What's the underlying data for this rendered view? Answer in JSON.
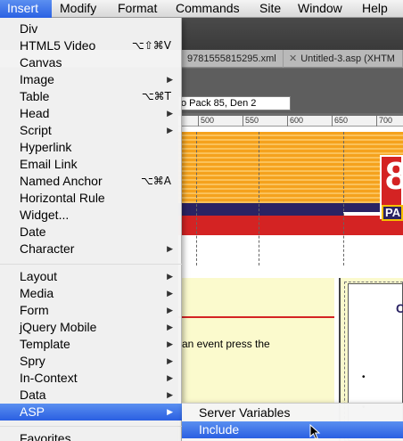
{
  "menubar": {
    "items": [
      {
        "label": "Insert"
      },
      {
        "label": "Modify"
      },
      {
        "label": "Format"
      },
      {
        "label": "Commands"
      },
      {
        "label": "Site"
      },
      {
        "label": "Window"
      },
      {
        "label": "Help"
      }
    ],
    "active_index": 0
  },
  "document": {
    "tabs": [
      {
        "label": "9781555815295.xml"
      },
      {
        "label": "Untitled-3.asp (XHTM"
      }
    ],
    "title_field_value": "o Pack 85, Den 2",
    "ruler_ticks": [
      "500",
      "550",
      "600",
      "650",
      "700"
    ],
    "logo_digit": "8",
    "logo_sub": "PA",
    "body_text": "an event press the",
    "right_heading": "C",
    "bullets": [
      "•",
      "•"
    ]
  },
  "insert_menu": {
    "items": [
      {
        "label": "Div",
        "shortcut": "",
        "submenu": false
      },
      {
        "label": "HTML5 Video",
        "shortcut": "⌥⇧⌘V",
        "submenu": false
      },
      {
        "label": "Canvas",
        "shortcut": "",
        "submenu": false
      },
      {
        "label": "Image",
        "shortcut": "",
        "submenu": true
      },
      {
        "label": "Table",
        "shortcut": "⌥⌘T",
        "submenu": false
      },
      {
        "label": "Head",
        "shortcut": "",
        "submenu": true
      },
      {
        "label": "Script",
        "shortcut": "",
        "submenu": true
      },
      {
        "label": "Hyperlink",
        "shortcut": "",
        "submenu": false
      },
      {
        "label": "Email Link",
        "shortcut": "",
        "submenu": false
      },
      {
        "label": "Named Anchor",
        "shortcut": "⌥⌘A",
        "submenu": false
      },
      {
        "label": "Horizontal Rule",
        "shortcut": "",
        "submenu": false
      },
      {
        "label": "Widget...",
        "shortcut": "",
        "submenu": false
      },
      {
        "label": "Date",
        "shortcut": "",
        "submenu": false
      },
      {
        "label": "Character",
        "shortcut": "",
        "submenu": true
      },
      {
        "label": "Layout",
        "shortcut": "",
        "submenu": true
      },
      {
        "label": "Media",
        "shortcut": "",
        "submenu": true
      },
      {
        "label": "Form",
        "shortcut": "",
        "submenu": true
      },
      {
        "label": "jQuery Mobile",
        "shortcut": "",
        "submenu": true
      },
      {
        "label": "Template",
        "shortcut": "",
        "submenu": true
      },
      {
        "label": "Spry",
        "shortcut": "",
        "submenu": true
      },
      {
        "label": "In-Context",
        "shortcut": "",
        "submenu": true
      },
      {
        "label": "Data",
        "shortcut": "",
        "submenu": true
      },
      {
        "label": "ASP",
        "shortcut": "",
        "submenu": true,
        "selected": true
      },
      {
        "label": "Favorites",
        "shortcut": "",
        "submenu": false
      }
    ],
    "arrow_glyph": "▶"
  },
  "asp_submenu": {
    "items": [
      {
        "label": "Server Variables",
        "selected": false
      },
      {
        "label": "Include",
        "selected": true
      }
    ]
  },
  "colors": {
    "highlight": "#2a5fe2",
    "stripe_orange": "#f5a21d",
    "navy": "#2b2363",
    "red": "#d42323",
    "content_yellow": "#fbfacd"
  }
}
